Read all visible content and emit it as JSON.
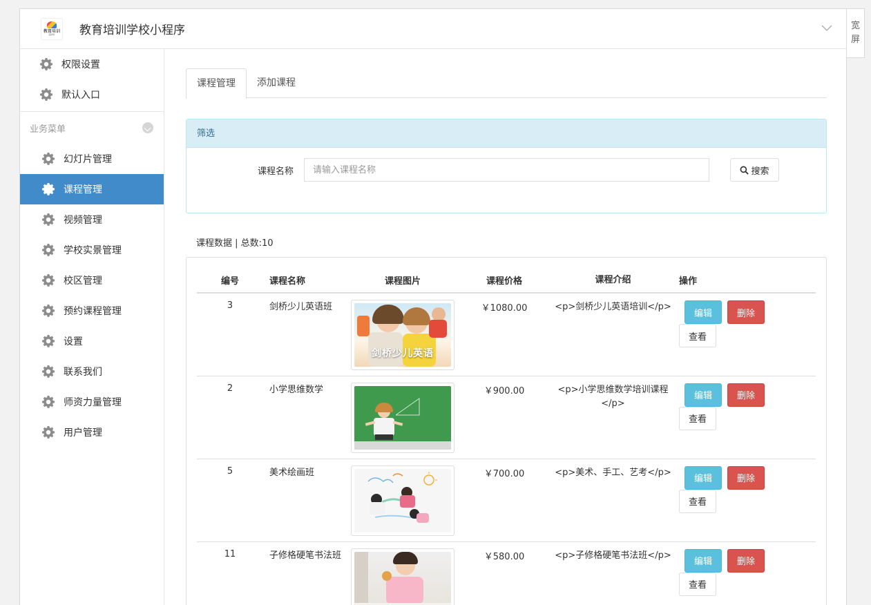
{
  "header": {
    "logo_text": "教育培训",
    "logo_sub": "品牌标",
    "app_title": "教育培训学校小程序"
  },
  "wide_screen": {
    "line1": "宽",
    "line2": "屏"
  },
  "sidebar": {
    "top_items": [
      {
        "label": "权限设置"
      },
      {
        "label": "默认入口"
      }
    ],
    "group_title": "业务菜单",
    "items": [
      {
        "label": "幻灯片管理",
        "active": false
      },
      {
        "label": "课程管理",
        "active": true
      },
      {
        "label": "视频管理",
        "active": false
      },
      {
        "label": "学校实景管理",
        "active": false
      },
      {
        "label": "校区管理",
        "active": false
      },
      {
        "label": "预约课程管理",
        "active": false
      },
      {
        "label": "设置",
        "active": false
      },
      {
        "label": "联系我们",
        "active": false
      },
      {
        "label": "师资力量管理",
        "active": false
      },
      {
        "label": "用户管理",
        "active": false
      }
    ]
  },
  "tabs": [
    {
      "label": "课程管理",
      "active": true
    },
    {
      "label": "添加课程",
      "active": false
    }
  ],
  "filter": {
    "heading": "筛选",
    "name_label": "课程名称",
    "name_placeholder": "请输入课程名称",
    "search_label": "搜索"
  },
  "data_caption": "课程数据 | 总数:10",
  "table": {
    "headers": [
      "编号",
      "课程名称",
      "课程图片",
      "课程价格",
      "课程介绍",
      "操作"
    ],
    "rows": [
      {
        "id": "3",
        "name": "剑桥少儿英语班",
        "image_caption": "剑桥少儿英语",
        "price": "￥1080.00",
        "intro": "<p>剑桥少儿英语培训</p>"
      },
      {
        "id": "2",
        "name": "小学思维数学",
        "image_caption": "",
        "price": "￥900.00",
        "intro": "<p>小学思维数学培训课程</p>"
      },
      {
        "id": "5",
        "name": "美术绘画班",
        "image_caption": "",
        "price": "￥700.00",
        "intro": "<p>美术、手工、艺考</p>"
      },
      {
        "id": "11",
        "name": "子修格硬笔书法班",
        "image_caption": "",
        "price": "￥580.00",
        "intro": "<p>子修格硬笔书法班</p>"
      }
    ],
    "edit_label": "编辑",
    "delete_label": "删除",
    "view_label": "查看"
  },
  "colors": {
    "primary": "#428bca",
    "info": "#5bc0de",
    "danger": "#d9534f",
    "panel_heading_bg": "#d9edf7"
  }
}
